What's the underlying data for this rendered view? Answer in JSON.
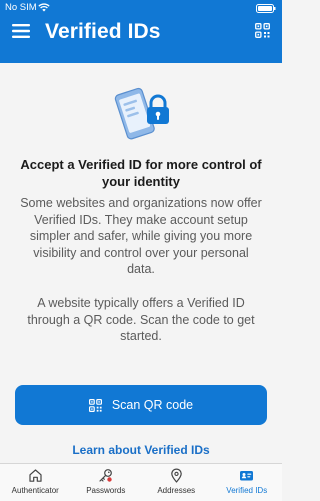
{
  "status": {
    "carrier": "No SIM",
    "time": ""
  },
  "header": {
    "title": "Verified IDs"
  },
  "content": {
    "headline": "Accept a Verified ID for more control of your identity",
    "paragraph1": "Some websites and organizations now offer Verified IDs. They make account setup simpler and safer, while giving you more visibility and control over your personal data.",
    "paragraph2": "A website typically offers a Verified ID through a QR code. Scan the code to get started.",
    "scan_button_label": "Scan QR code",
    "learn_link_label": "Learn about Verified IDs"
  },
  "tabs": [
    {
      "label": "Authenticator",
      "icon": "home-icon",
      "active": false
    },
    {
      "label": "Passwords",
      "icon": "key-icon",
      "active": false
    },
    {
      "label": "Addresses",
      "icon": "location-pin-icon",
      "active": false
    },
    {
      "label": "Verified IDs",
      "icon": "verified-id-icon",
      "active": true
    }
  ],
  "colors": {
    "accent": "#1178d4",
    "link": "#1a6fc7",
    "background": "#f4f4f4"
  }
}
